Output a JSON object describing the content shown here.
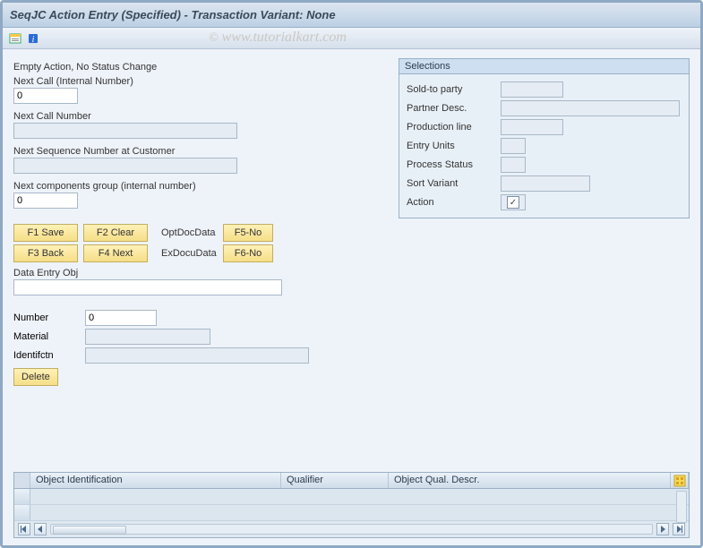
{
  "title": "SeqJC Action Entry (Specified) - Transaction Variant: None",
  "watermark": {
    "cc": "©",
    "text": " www.tutorialkart.com"
  },
  "left": {
    "status": "Empty Action, No Status Change",
    "nextCallInternal": {
      "label": "Next Call (Internal Number)",
      "value": "0"
    },
    "nextCallNumber": {
      "label": "Next Call Number",
      "value": ""
    },
    "nextSeq": {
      "label": "Next Sequence Number at Customer",
      "value": ""
    },
    "nextComp": {
      "label": "Next components group (internal number)",
      "value": "0"
    },
    "buttons": {
      "f1": "F1 Save",
      "f2": "F2 Clear",
      "opt": "OptDocData",
      "f5": "F5-No",
      "f3": "F3 Back",
      "f4": "F4 Next",
      "ex": "ExDocuData",
      "f6": "F6-No"
    },
    "dataEntry": {
      "label": "Data Entry Obj",
      "value": ""
    },
    "number": {
      "label": "Number",
      "value": "0"
    },
    "material": {
      "label": "Material",
      "value": ""
    },
    "ident": {
      "label": "Identifctn",
      "value": ""
    },
    "delete": "Delete"
  },
  "selections": {
    "title": "Selections",
    "rows": {
      "soldTo": {
        "label": "Sold-to party",
        "value": ""
      },
      "partner": {
        "label": "Partner Desc.",
        "value": ""
      },
      "prodLine": {
        "label": "Production line",
        "value": ""
      },
      "entryUnits": {
        "label": "Entry Units",
        "value": ""
      },
      "procStatus": {
        "label": "Process Status",
        "value": ""
      },
      "sortVariant": {
        "label": "Sort Variant",
        "value": ""
      },
      "action": {
        "label": "Action",
        "checked": true
      }
    }
  },
  "grid": {
    "cols": {
      "c1": "Object Identification",
      "c2": "Qualifier",
      "c3": "Object Qual. Descr."
    }
  }
}
